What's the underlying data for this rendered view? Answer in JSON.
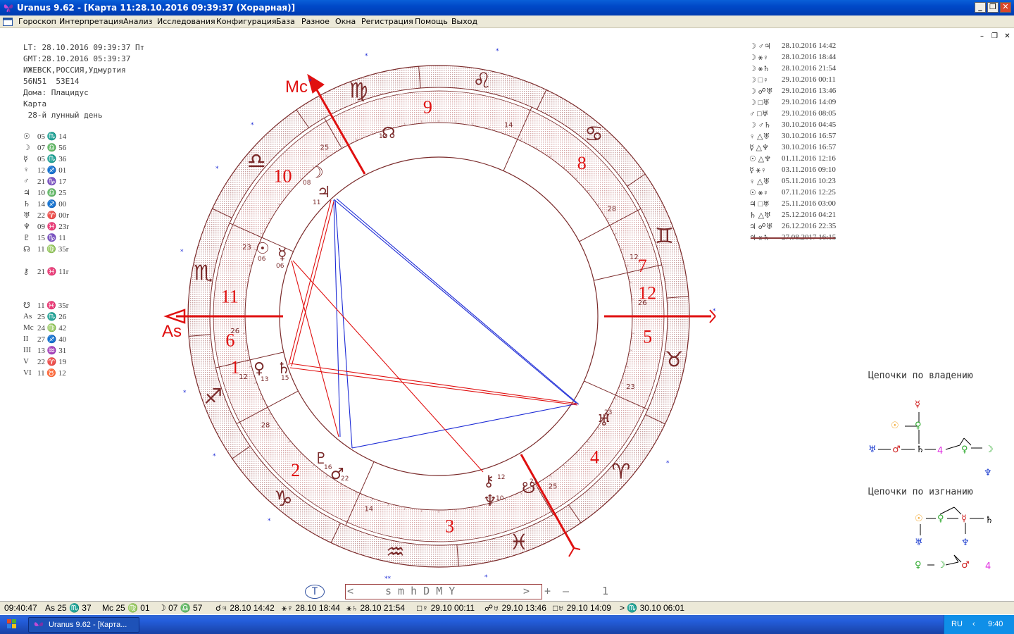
{
  "window": {
    "title": "Uranus 9.62 - [Карта 11:28.10.2016 09:39:37 (Хорарная)]",
    "app_icon": "butterfly-icon"
  },
  "menu": [
    "Гороскоп",
    "Интерпретация",
    "Анализ",
    "Исследования",
    "Конфигурация",
    "База",
    "Разное",
    "Окна",
    "Регистрация",
    "Помощь",
    "Выход"
  ],
  "info": {
    "lt": "LT: 28.10.2016 09:39:37 Пт",
    "gmt": "GMT:28.10.2016 05:39:37",
    "place": "ИЖЕВСК,РОССИЯ,Удмуртия",
    "coords": "56N51  53E14",
    "houses": "Дома: Плацидус",
    "kind": "Карта",
    "lunar_day": " 28-й лунный день"
  },
  "planets": [
    {
      "sym": "☉",
      "val": "05 ♏ 14"
    },
    {
      "sym": "☽",
      "val": "07 ♎ 56"
    },
    {
      "sym": "☿",
      "val": "05 ♏ 36"
    },
    {
      "sym": "♀",
      "val": "12 ♐ 01"
    },
    {
      "sym": "♂",
      "val": "21 ♑ 17"
    },
    {
      "sym": "♃",
      "val": "10 ♎ 25"
    },
    {
      "sym": "♄",
      "val": "14 ♐ 00"
    },
    {
      "sym": "♅",
      "val": "22 ♈ 00r"
    },
    {
      "sym": "♆",
      "val": "09 ♓ 23r"
    },
    {
      "sym": "♇",
      "val": "15 ♑ 11"
    },
    {
      "sym": "☊",
      "val": "11 ♍ 35r"
    },
    {
      "sym": "⚷",
      "val": "21 ♓ 11r"
    },
    {
      "sym": "☋",
      "val": "11 ♓ 35r"
    },
    {
      "sym": "As",
      "val": "25 ♏ 26"
    },
    {
      "sym": "Mc",
      "val": "24 ♍ 42"
    },
    {
      "sym": "II",
      "val": "27 ♐ 40"
    },
    {
      "sym": "III",
      "val": "13 ♒ 31"
    },
    {
      "sym": "V",
      "val": "22 ♈ 19"
    },
    {
      "sym": "VI",
      "val": "11 ♉ 12"
    }
  ],
  "aspects": [
    {
      "p": "☽ ♂♃",
      "d": "28.10.2016 14:42"
    },
    {
      "p": "☽ ⚹♀",
      "d": "28.10.2016 18:44"
    },
    {
      "p": "☽ ⚹♄",
      "d": "28.10.2016 21:54"
    },
    {
      "p": "☽ □♀",
      "d": "29.10.2016 00:11"
    },
    {
      "p": "☽ ☍♅",
      "d": "29.10.2016 13:46"
    },
    {
      "p": "☽ □♅",
      "d": "29.10.2016 14:09"
    },
    {
      "p": "♂ □♅",
      "d": "29.10.2016 08:05"
    },
    {
      "p": "☽ ♂♄",
      "d": "30.10.2016 04:45"
    },
    {
      "p": "♀ △♅",
      "d": "30.10.2016 16:57"
    },
    {
      "p": "☿ △♆",
      "d": "30.10.2016 16:57"
    },
    {
      "p": "☉ △♆",
      "d": "01.11.2016 12:16"
    },
    {
      "p": "☿ ⚹♀",
      "d": "03.11.2016 09:10"
    },
    {
      "p": "♀ △♅",
      "d": "05.11.2016 10:23"
    },
    {
      "p": "☉ ⚹♀",
      "d": "07.11.2016 12:25"
    },
    {
      "p": "♃ □♅",
      "d": "25.11.2016 03:00"
    },
    {
      "p": "♄ △♅",
      "d": "25.12.2016 04:21"
    },
    {
      "p": "♃ ☍♅",
      "d": "26.12.2016 22:35"
    },
    {
      "p": "♃ ⚹♄",
      "d": "27.08.2017 16:15"
    }
  ],
  "chains": {
    "ownership_label": "Цепочки по владению",
    "exile_label": "Цепочки по изгнанию"
  },
  "axes": {
    "asc": "As",
    "mc": "Mc"
  },
  "house_numbers": [
    "1",
    "2",
    "3",
    "4",
    "5",
    "6",
    "7",
    "8",
    "9",
    "10",
    "11",
    "12"
  ],
  "cusp_degrees": [
    "26",
    "28",
    "14",
    "25",
    "23",
    "12",
    "26",
    "28",
    "14",
    "25",
    "23",
    "12"
  ],
  "zodiac": [
    "♈",
    "♉",
    "♊",
    "♋",
    "♌",
    "♍",
    "♎",
    "♏",
    "♐",
    "♑",
    "♒",
    "♓"
  ],
  "timebar": {
    "circle": "T",
    "left": "<",
    "units": "s m h D M Y",
    "right": ">",
    "plus": "+",
    "minus": "–",
    "step": "1"
  },
  "status": {
    "time": "09:40:47",
    "asc": "As 25 ♏ 37",
    "mc": "Mc 25 ♍ 01",
    "moon": "☽ 07 ♎ 57",
    "a1": "☌♃ 28.10 14:42",
    "a2": "⚹♀ 28.10 18:44",
    "a3": "⚹♄ 28.10 21:54",
    "a4": "□♀ 29.10 00:11",
    "a5": "☍♅ 29.10 13:46",
    "a6": "□♅ 29.10 14:09",
    "a7": "> ♏ 30.10 06:01"
  },
  "taskbar": {
    "task": "Uranus 9.62 - [Карта...",
    "lang": "RU",
    "clock": "9:40"
  },
  "colors": {
    "red": "#e01010",
    "maroon": "#7a2a2a",
    "blue": "#1d2bd6",
    "band": "#f4d8d8"
  }
}
